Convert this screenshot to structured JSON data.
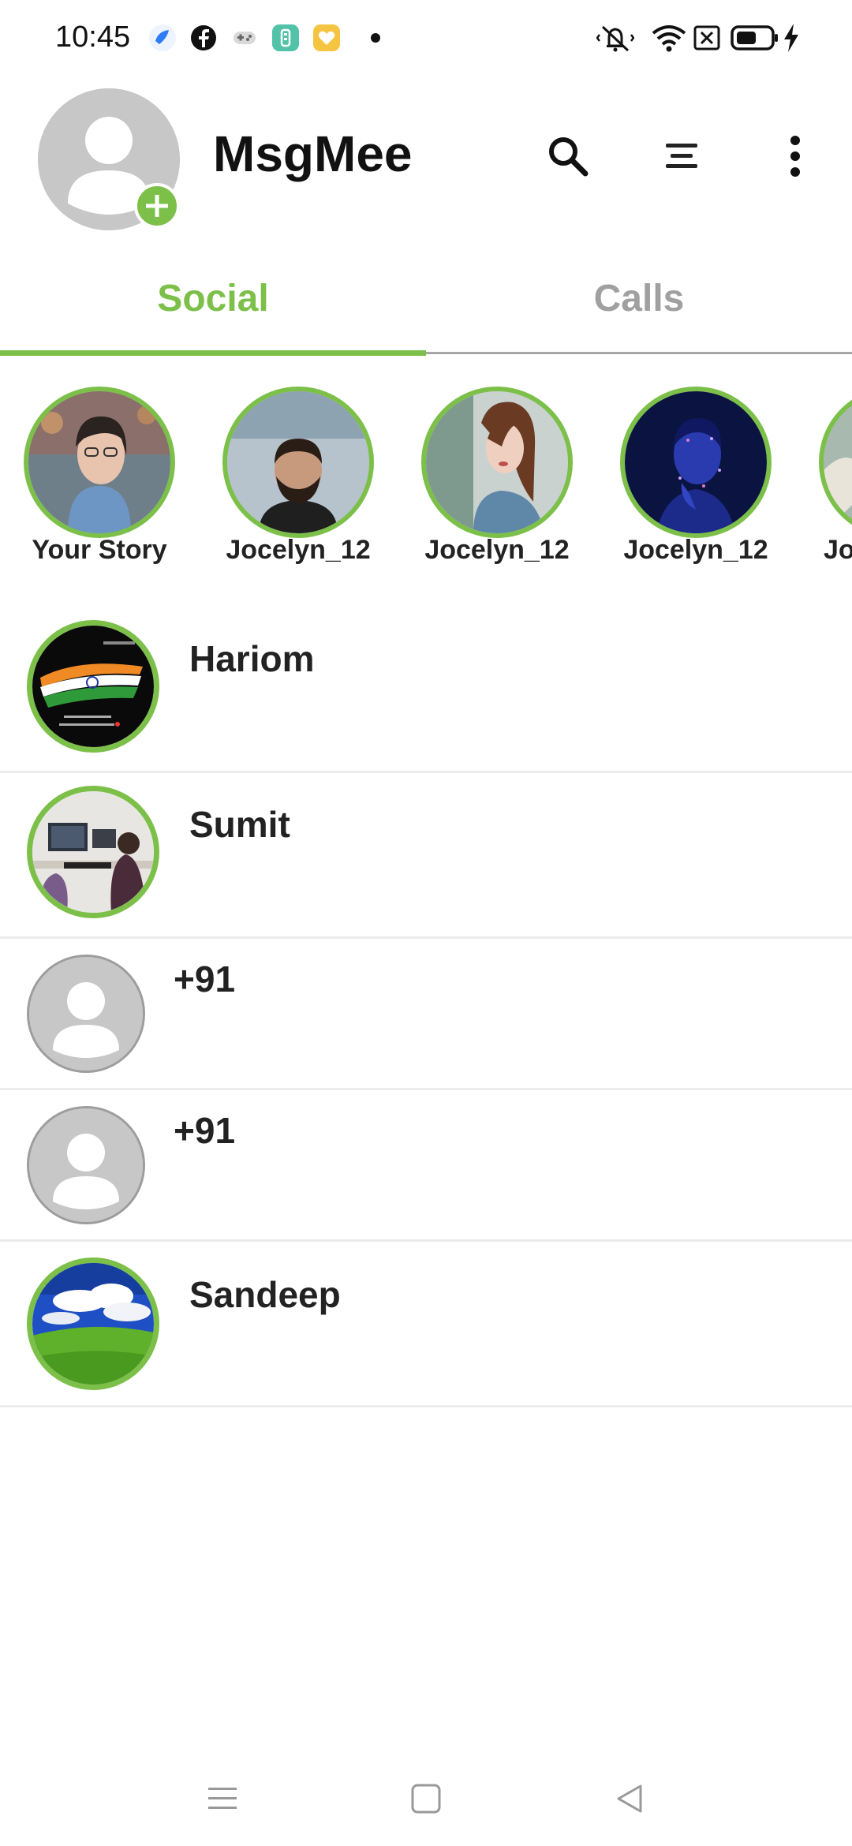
{
  "status_bar": {
    "time": "10:45",
    "notification_icons": [
      "bluebird-icon",
      "facebook-icon",
      "gamepad-icon",
      "teal-app-icon",
      "yellow-heart-app-icon",
      "dot-icon"
    ],
    "system_icons": [
      "vibrate-mute-icon",
      "wifi-icon",
      "no-sim-icon",
      "battery-icon",
      "charging-icon"
    ]
  },
  "header": {
    "title": "MsgMee",
    "icons": [
      "search-icon",
      "filter-icon",
      "more-vert-icon"
    ]
  },
  "tabs": [
    {
      "label": "Social",
      "active": true
    },
    {
      "label": "Calls",
      "active": false
    }
  ],
  "colors": {
    "accent": "#7cc04a",
    "inactive_tab": "#a0a0a0",
    "placeholder_avatar": "#c7c7c7",
    "divider": "#ececec"
  },
  "stories": [
    {
      "label": "Your Story",
      "image": "woman-with-glasses-photo"
    },
    {
      "label": "Jocelyn_12",
      "image": "bearded-man-photo"
    },
    {
      "label": "Jocelyn_12",
      "image": "woman-profile-photo"
    },
    {
      "label": "Jocelyn_12",
      "image": "blue-glitter-portrait-photo"
    },
    {
      "label": "Jo",
      "image": "partial-story-photo"
    }
  ],
  "chats": [
    {
      "name": "Hariom",
      "avatar": "india-flag-image",
      "ring": true
    },
    {
      "name": "Sumit",
      "avatar": "office-desk-photo",
      "ring": true
    },
    {
      "name": "+91",
      "avatar": "default-person-icon",
      "ring": false
    },
    {
      "name": "+91",
      "avatar": "default-person-icon",
      "ring": false
    },
    {
      "name": "Sandeep",
      "avatar": "green-field-sky-photo",
      "ring": true
    }
  ],
  "nav_bar": [
    "recents-icon",
    "home-icon",
    "back-icon"
  ]
}
